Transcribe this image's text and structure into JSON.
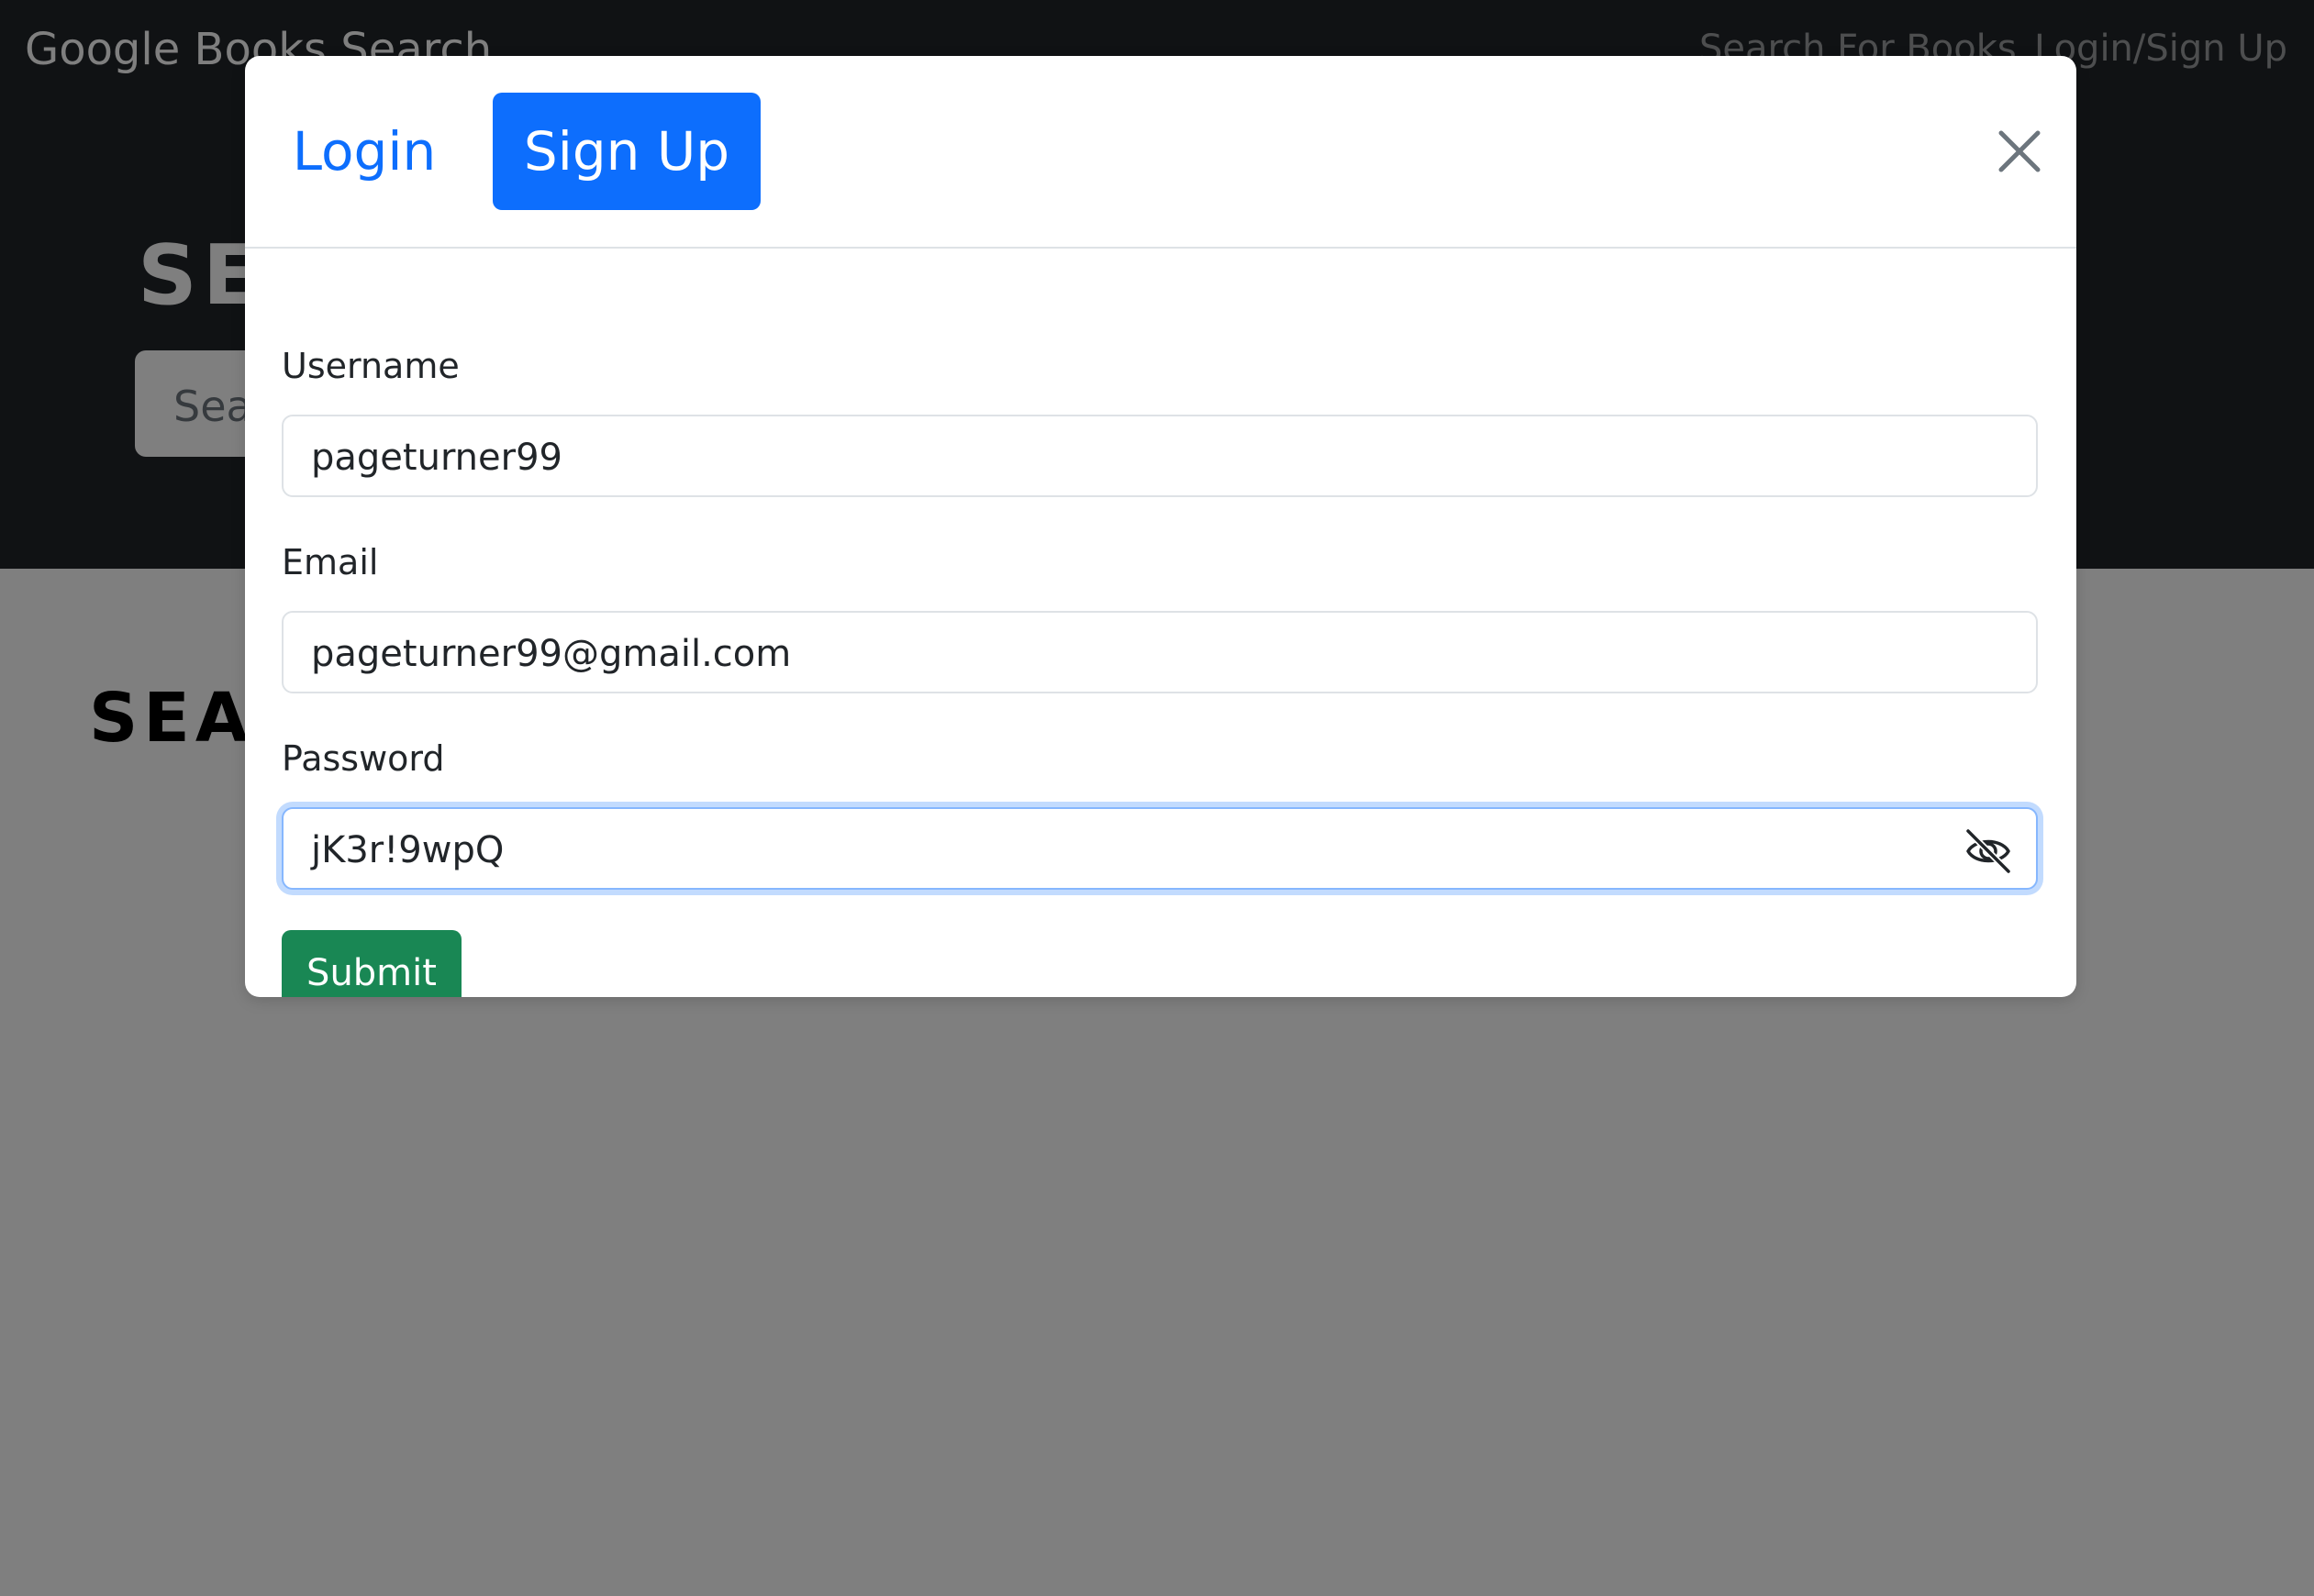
{
  "navbar": {
    "brand": "Google Books Search",
    "links": [
      "Search For Books",
      "Login/Sign Up"
    ]
  },
  "hero": {
    "title": "SE",
    "search_placeholder": "Sea"
  },
  "results": {
    "title": "SEA"
  },
  "modal": {
    "tabs": [
      {
        "label": "Login",
        "active": false
      },
      {
        "label": "Sign Up",
        "active": true
      }
    ],
    "close_icon": "close-icon",
    "fields": [
      {
        "label": "Username",
        "value": "pageturner99"
      },
      {
        "label": "Email",
        "value": "pageturner99@gmail.com"
      },
      {
        "label": "Password",
        "value": "jK3r!9wpQ",
        "focused": true,
        "toggle_icon": "eye-slash-icon"
      }
    ],
    "submit_label": "Submit"
  },
  "colors": {
    "primary": "#0d6efd",
    "success": "#198754",
    "dark": "#212529",
    "backdrop": "rgba(0,0,0,0.5)"
  }
}
